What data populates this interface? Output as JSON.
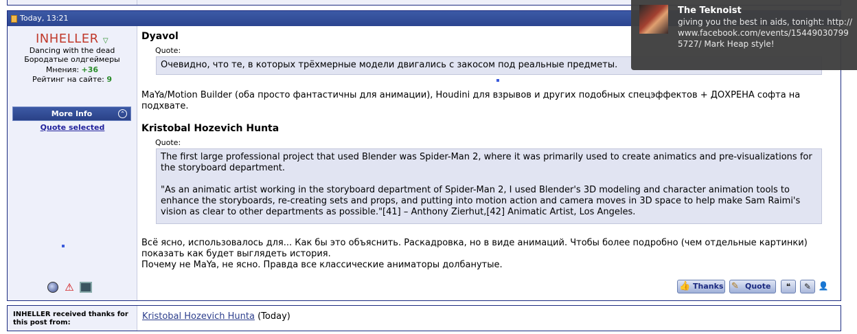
{
  "post": {
    "date": "Today, 13:21",
    "user": {
      "name": "INHELLER",
      "title_lines": [
        "Dancing with the dead",
        "Бородатые олдгеймеры"
      ],
      "opinions_label": "Мнения:",
      "opinions_value": "+36",
      "rating_label": "Рейтинг на сайте:",
      "rating_value": "9",
      "more_info_label": "More Info",
      "quote_selected_label": "Quote selected"
    },
    "blocks": [
      {
        "author": "Dyavol",
        "quote_label": "Quote:",
        "quote_text": "Очевидно, что те, в которых трёхмерные модели двигались с закосом под реальные предметы."
      },
      {
        "reply": "MaYa/Motion Builder (оба просто фантастичны для анимации), Houdini для взрывов и других подобных спецэффектов + ДОХРЕНА софта на подхвате."
      },
      {
        "author": "Kristobal Hozevich Hunta",
        "quote_label": "Quote:",
        "quote_p1": "The first large professional project that used Blender was Spider-Man 2, where it was primarily used to create animatics and pre-visualizations for the storyboard department.",
        "quote_p2": "\"As an animatic artist working in the storyboard department of Spider-Man 2, I used Blender's 3D modeling and character animation tools to enhance the storyboards, re-creating sets and props, and putting into motion action and camera moves in 3D space to help make Sam Raimi's vision as clear to other departments as possible.\"[41] – Anthony Zierhut,[42] Animatic Artist, Los Angeles."
      },
      {
        "reply_lines": [
          "Всё ясно, использовалось для... Как бы это объяснить. Раскадровка, но в виде анимаций. Чтобы более подробно (чем отдельные картинки) показать как будет выглядеть история.",
          "Почему не MaYa, не ясно. Правда все классические аниматоры долбанутые."
        ]
      }
    ],
    "actions": {
      "thanks_label": "Thanks",
      "quote_label": "Quote"
    }
  },
  "thanks": {
    "label": "INHELLER received thanks for this post from:",
    "user": "Kristobal Hozevich Hunta",
    "when": "(Today)"
  },
  "notification": {
    "title": "The Teknoist",
    "body": "giving you the best in aids, tonight: http://www.facebook.com/events/154490307995727/ Mark Heap style!"
  },
  "icons": [
    "doc-icon",
    "online-status-icon",
    "report-icon",
    "computer-icon",
    "thanks-icon",
    "quote-icon",
    "multiquote-icon",
    "edit-icon",
    "user-icon"
  ],
  "colors": {
    "header_bg": "#2c4590",
    "username": "#c0392b",
    "positive": "#2a8c2a",
    "quote_bg": "#e1e4f2",
    "link": "#2c3e8c"
  }
}
